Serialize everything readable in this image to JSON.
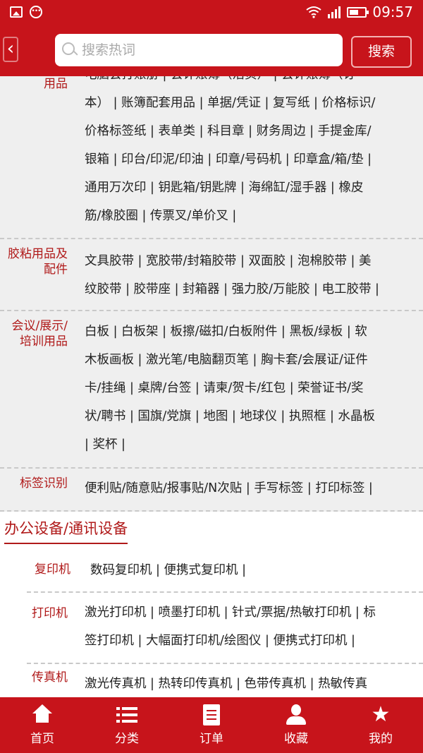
{
  "status_bar": {
    "time": "09:57",
    "wifi": "wifi-icon",
    "signal": "signal-icon",
    "battery": "battery-icon"
  },
  "header": {
    "back_icon": "‹",
    "search_placeholder": "搜索热词",
    "search_button": "搜索"
  },
  "categories": [
    {
      "label": "用品",
      "lines": [
        "电脑会打账册 | 会计账簿（活页） | 会计账簿（订",
        "本） | 账簿配套用品 | 单据/凭证 | 复写纸 | 价格标识/",
        "价格标签纸 | 表单类 | 科目章 | 财务周边 | 手提金库/",
        "银箱 | 印台/印泥/印油 | 印章/号码机 | 印章盒/箱/垫 |",
        "通用万次印 | 钥匙箱/钥匙牌 | 海绵缸/湿手器 | 橡皮",
        "筋/橡胶圈 | 传票叉/单价叉 |"
      ]
    },
    {
      "label": "胶粘用品及配件",
      "lines": [
        "文具胶带 | 宽胶带/封箱胶带 | 双面胶 | 泡棉胶带 | 美",
        "纹胶带 | 胶带座 | 封箱器 | 强力胶/万能胶 | 电工胶带 |"
      ]
    },
    {
      "label": "会议/展示/培训用品",
      "lines": [
        "白板 | 白板架 | 板擦/磁扣/白板附件 | 黑板/绿板 | 软",
        "木板画板 | 激光笔/电脑翻页笔 | 胸卡套/会展证/证件",
        "卡/挂绳 | 桌牌/台签 | 请柬/贺卡/红包 | 荣誉证书/奖",
        "状/聘书 | 国旗/党旗 | 地图 | 地球仪 | 执照框 | 水晶板",
        "| 奖杯 |"
      ]
    },
    {
      "label": "标签识别",
      "lines": [
        "便利贴/随意贴/报事贴/N次贴 | 手写标签 | 打印标签 |"
      ]
    }
  ],
  "section": {
    "title": "办公设备/通讯设备",
    "categories": [
      {
        "label": "复印机",
        "lines": [
          "数码复印机 | 便携式复印机 |"
        ]
      },
      {
        "label": "打印机",
        "lines": [
          "激光打印机 | 喷墨打印机 | 针式/票据/热敏打印机 | 标",
          "签打印机 | 大幅面打印机/绘图仪 | 便携式打印机 |"
        ]
      },
      {
        "label": "传真机",
        "lines": [
          "激光传真机 | 热转印传真机 | 色带传真机 | 热敏传真"
        ]
      }
    ]
  },
  "bottom_nav": [
    {
      "label": "首页",
      "icon": "home-icon"
    },
    {
      "label": "分类",
      "icon": "list-icon"
    },
    {
      "label": "订单",
      "icon": "order-icon"
    },
    {
      "label": "收藏",
      "icon": "user-icon"
    },
    {
      "label": "我的",
      "icon": "star-icon"
    }
  ],
  "colors": {
    "brand": "#c7141b",
    "label": "#b01a1a"
  }
}
